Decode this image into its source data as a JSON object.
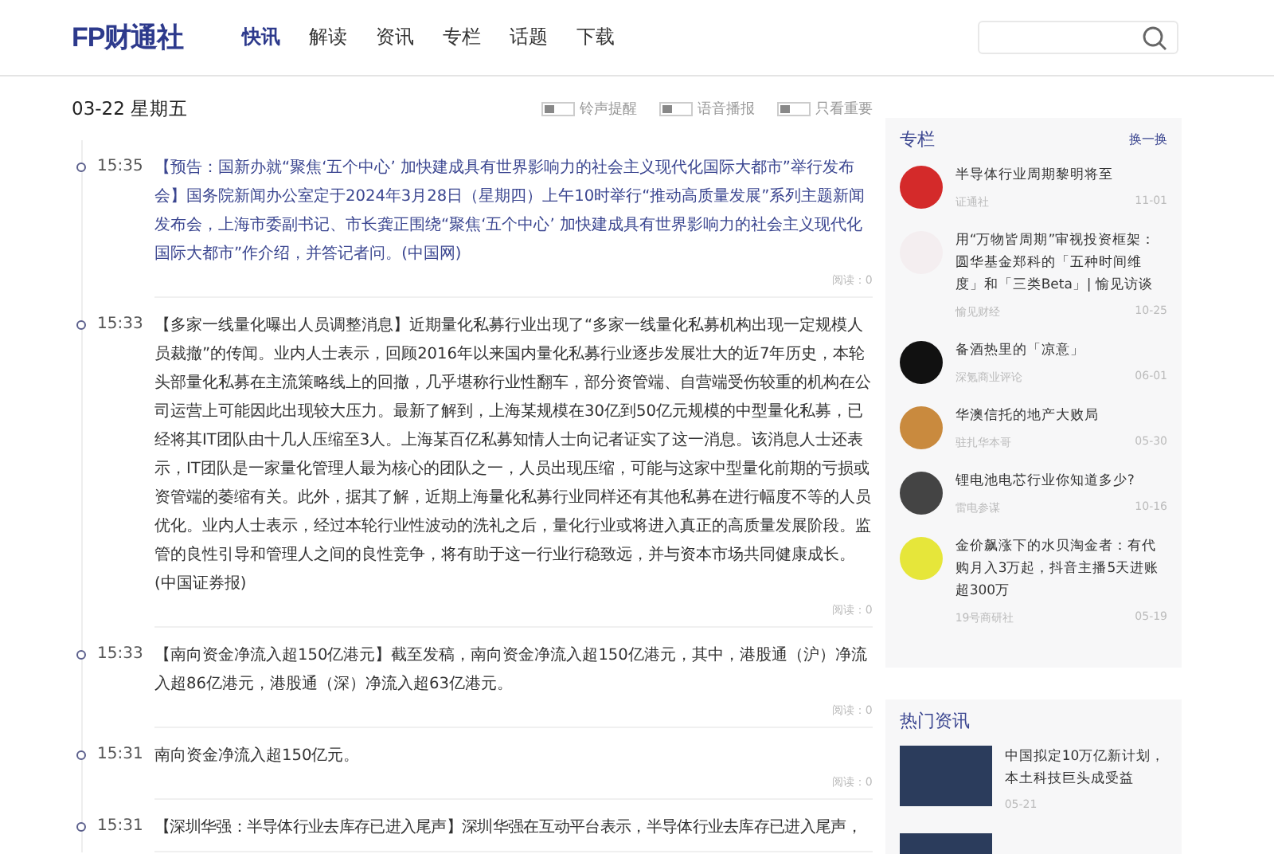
{
  "logo": "FP财通社",
  "nav": [
    {
      "label": "快讯",
      "selected": true
    },
    {
      "label": "解读",
      "selected": false
    },
    {
      "label": "资讯",
      "selected": false
    },
    {
      "label": "专栏",
      "selected": false
    },
    {
      "label": "话题",
      "selected": false
    },
    {
      "label": "下载",
      "selected": false
    }
  ],
  "date": "03-22 星期五",
  "toggles": [
    {
      "label": "铃声提醒",
      "on": false
    },
    {
      "label": "语音播报",
      "on": false
    },
    {
      "label": "只看重要",
      "on": false
    }
  ],
  "news": [
    {
      "time": "15:35",
      "important": true,
      "text": "【预告：国新办就“聚焦‘五个中心’ 加快建成具有世界影响力的社会主义现代化国际大都市”举行发布会】国务院新闻办公室定于2024年3月28日（星期四）上午10时举行“推动高质量发展”系列主题新闻发布会，上海市委副书记、市长龚正围绕“聚焦‘五个中心’ 加快建成具有世界影响力的社会主义现代化国际大都市”作介绍，并答记者问。(中国网)",
      "reads": "阅读：0"
    },
    {
      "time": "15:33",
      "important": false,
      "text": "【多家一线量化曝出人员调整消息】近期量化私募行业出现了“多家一线量化私募机构出现一定规模人员裁撤”的传闻。业内人士表示，回顾2016年以来国内量化私募行业逐步发展壮大的近7年历史，本轮头部量化私募在主流策略线上的回撤，几乎堪称行业性翻车，部分资管端、自营端受伤较重的机构在公司运营上可能因此出现较大压力。最新了解到，上海某规模在30亿到50亿元规模的中型量化私募，已经将其IT团队由十几人压缩至3人。上海某百亿私募知情人士向记者证实了这一消息。该消息人士还表示，IT团队是一家量化管理人最为核心的团队之一，人员出现压缩，可能与这家中型量化前期的亏损或资管端的萎缩有关。此外，据其了解，近期上海量化私募行业同样还有其他私募在进行幅度不等的人员优化。业内人士表示，经过本轮行业性波动的洗礼之后，量化行业或将进入真正的高质量发展阶段。监管的良性引导和管理人之间的良性竞争，将有助于这一行业行稳致远，并与资本市场共同健康成长。(中国证券报)",
      "reads": "阅读：0"
    },
    {
      "time": "15:33",
      "important": false,
      "text": "【南向资金净流入超150亿港元】截至发稿，南向资金净流入超150亿港元，其中，港股通（沪）净流入超86亿港元，港股通（深）净流入超63亿港元。",
      "reads": "阅读：0"
    },
    {
      "time": "15:31",
      "important": false,
      "text": "南向资金净流入超150亿元。",
      "reads": "阅读：0"
    },
    {
      "time": "15:31",
      "important": false,
      "text": "【深圳华强：半导体行业去库存已进入尾声】深圳华强在互动平台表示，半导体行业去库存已进入尾声，"
    }
  ],
  "column": {
    "title": "专栏",
    "action": "换一换",
    "items": [
      {
        "title": "半导体行业周期黎明将至",
        "source": "证通社",
        "date": "11-01",
        "color": "#d42a2a"
      },
      {
        "title": "用“万物皆周期”审视投资框架：圆华基金郑科的「五种时间维度」和「三类Beta」| 愉见访谈",
        "source": "愉见财经",
        "date": "10-25",
        "color": "#f4eef0"
      },
      {
        "title": "备酒热里的「凉意」",
        "source": "深氪商业评论",
        "date": "06-01",
        "color": "#111111"
      },
      {
        "title": "华澳信托的地产大败局",
        "source": "驻扎华本哥",
        "date": "05-30",
        "color": "#c98a3e"
      },
      {
        "title": "锂电池电芯行业你知道多少?",
        "source": "雷电参谋",
        "date": "10-16",
        "color": "#444444"
      },
      {
        "title": "金价飙涨下的水贝淘金者：有代购月入3万起，抖音主播5天进账超300万",
        "source": "19号商研社",
        "date": "05-19",
        "color": "#e6e63a"
      }
    ]
  },
  "hot": {
    "title": "热门资讯",
    "items": [
      {
        "title": "中国拟定10万亿新计划，本土科技巨头成受益",
        "date": "05-21"
      }
    ]
  }
}
